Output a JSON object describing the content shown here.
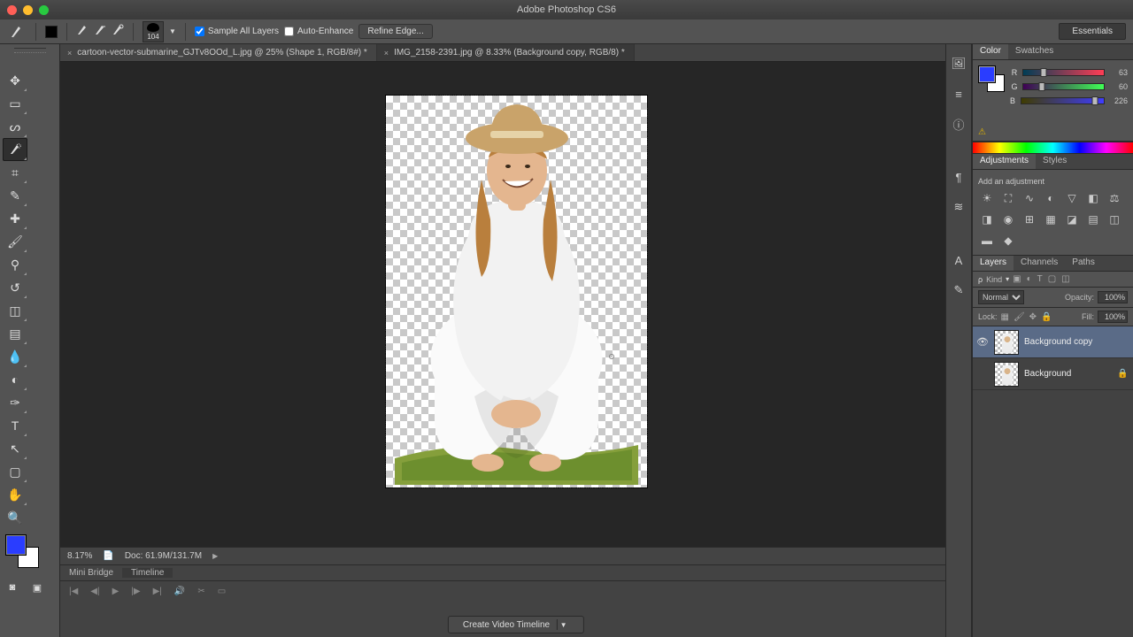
{
  "app": {
    "title": "Adobe Photoshop CS6"
  },
  "optionsbar": {
    "brush_size": "104",
    "sample_all": "Sample All Layers",
    "auto_enhance": "Auto-Enhance",
    "refine_edge": "Refine Edge...",
    "workspace": "Essentials"
  },
  "doctabs": [
    {
      "label": "cartoon-vector-submarine_GJTv8OOd_L.jpg @ 25% (Shape 1, RGB/8#) *"
    },
    {
      "label": "IMG_2158-2391.jpg @ 8.33% (Background copy, RGB/8) *",
      "active": true
    }
  ],
  "status": {
    "zoom": "8.17%",
    "doc": "Doc: 61.9M/131.7M"
  },
  "bottomtabs": {
    "a": "Mini Bridge",
    "b": "Timeline"
  },
  "timeline": {
    "button": "Create Video Timeline"
  },
  "panels": {
    "color": {
      "tab_color": "Color",
      "tab_swatches": "Swatches",
      "sliders": [
        {
          "lab": "R",
          "val": "63",
          "pct": 25,
          "grad": "linear-gradient(90deg,#003d55,#ff3d55)"
        },
        {
          "lab": "G",
          "val": "60",
          "pct": 23,
          "grad": "linear-gradient(90deg,#3f0055,#3fff55)"
        },
        {
          "lab": "B",
          "val": "226",
          "pct": 89,
          "grad": "linear-gradient(90deg,#3f3c00,#3f3cff)"
        }
      ]
    },
    "adjustments": {
      "tab_adj": "Adjustments",
      "tab_styles": "Styles",
      "heading": "Add an adjustment"
    },
    "layers": {
      "tab_layers": "Layers",
      "tab_channels": "Channels",
      "tab_paths": "Paths",
      "kind": "Kind",
      "blend": "Normal",
      "opacity_lab": "Opacity:",
      "opacity_val": "100%",
      "lock_lab": "Lock:",
      "fill_lab": "Fill:",
      "fill_val": "100%",
      "items": [
        {
          "name": "Background copy",
          "visible": true,
          "selected": true,
          "locked": false
        },
        {
          "name": "Background",
          "visible": false,
          "selected": false,
          "locked": true
        }
      ]
    }
  }
}
